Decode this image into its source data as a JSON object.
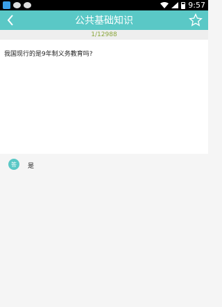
{
  "status_bar": {
    "time": "9:57",
    "icons": [
      "app-icon",
      "chat-icon",
      "wechat-icon",
      "wifi-icon",
      "signal-icon",
      "battery-icon"
    ]
  },
  "header": {
    "title": "公共基础知识",
    "back_icon": "chevron-left-icon",
    "favorite_icon": "star-icon"
  },
  "progress": {
    "text": "1/12988"
  },
  "question": {
    "text": "我国现行的是9年制义务教育吗?"
  },
  "answer": {
    "badge": "答",
    "text": "是"
  },
  "colors": {
    "accent": "#5ac8c6",
    "progress_text": "#8aa53a",
    "background": "#f5f5f5"
  }
}
